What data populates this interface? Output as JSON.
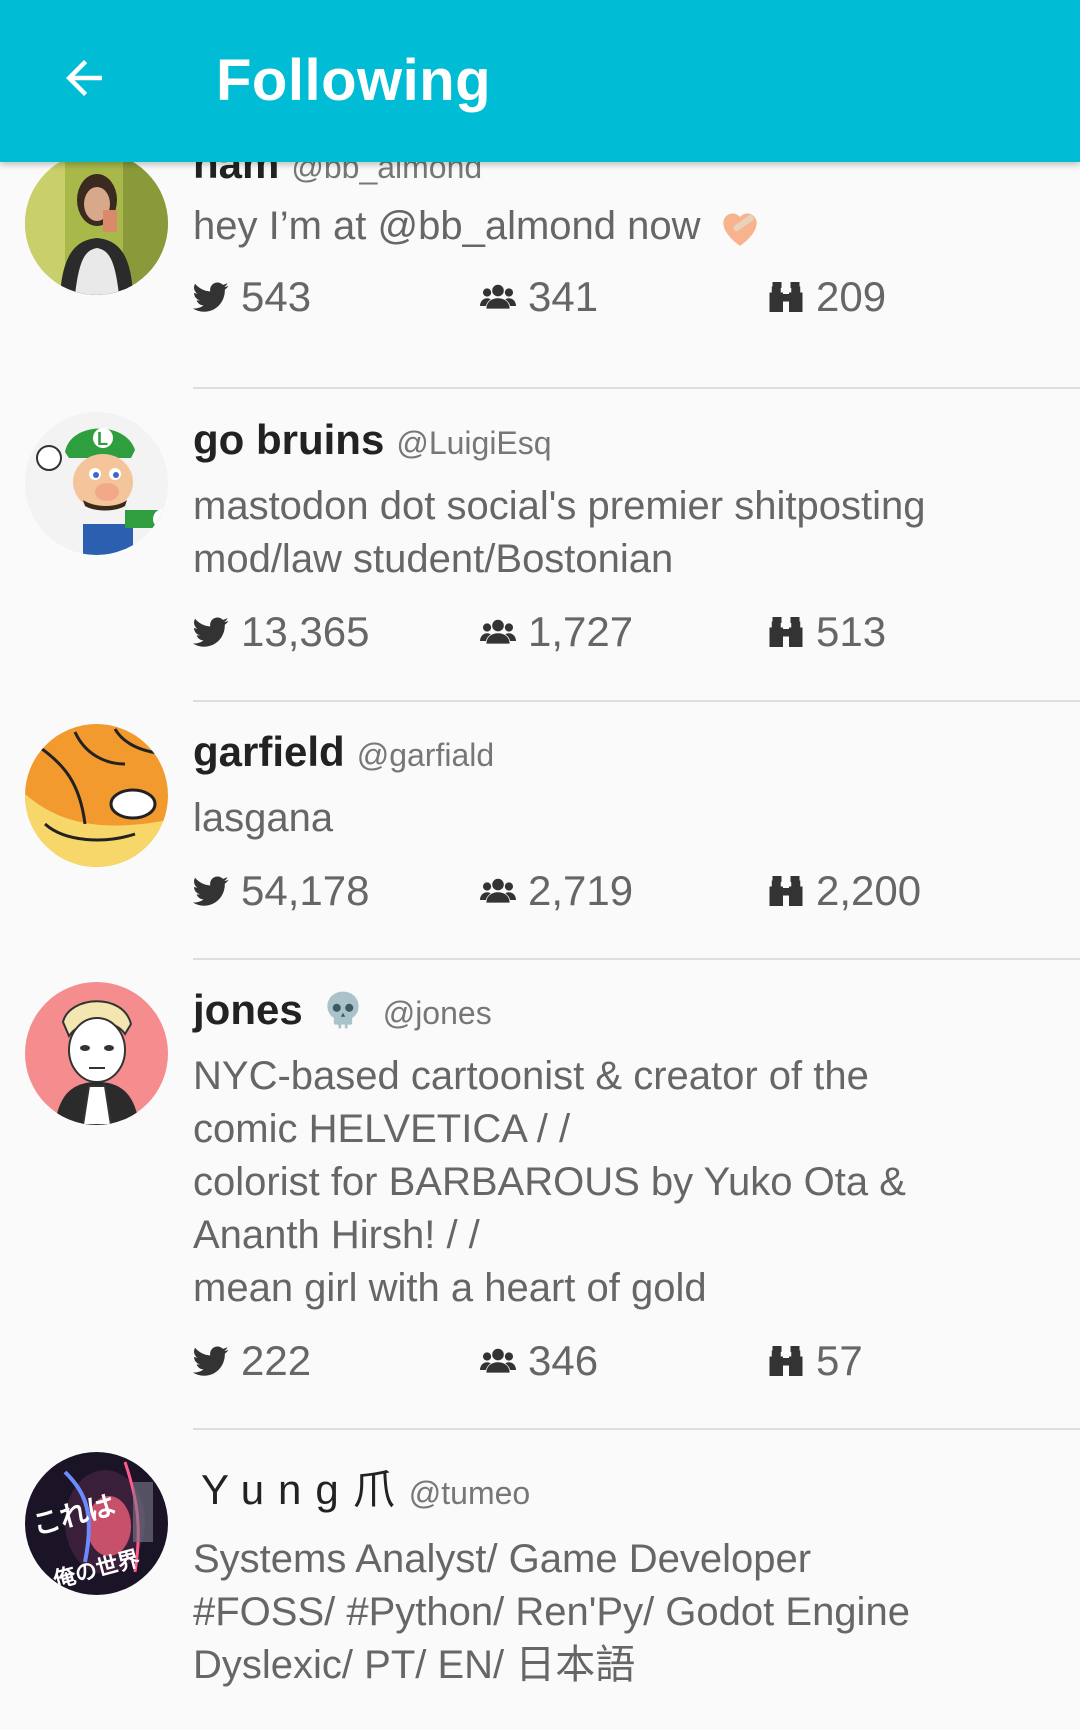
{
  "appbar": {
    "title": "Following",
    "back_icon": "arrow-left-icon",
    "background": "#00bcd4"
  },
  "accounts": [
    {
      "display_name": "ham",
      "handle": "@bb_almond",
      "bio": "hey I’m at @bb_almond now",
      "bio_emoji": "heart-with-bandage-emoji",
      "statuses": "543",
      "following": "341",
      "followers": "209"
    },
    {
      "display_name": "go bruins",
      "handle": "@LuigiEsq",
      "bio": "mastodon dot social's premier shitposting mod/law student/Bostonian",
      "statuses": "13,365",
      "following": "1,727",
      "followers": "513"
    },
    {
      "display_name": "garfield",
      "handle": "@garfiald",
      "bio": "lasgana",
      "statuses": "54,178",
      "following": "2,719",
      "followers": "2,200"
    },
    {
      "display_name": "jones",
      "name_emoji": "skull-emoji",
      "handle": "@jones",
      "bio": "NYC-based cartoonist & creator of the comic HELVETICA / /\ncolorist for BARBAROUS by Yuko Ota & Ananth Hirsh! / /\nmean girl with a heart of gold",
      "statuses": "222",
      "following": "346",
      "followers": "57"
    },
    {
      "display_name": "Yung爪",
      "handle": "@tumeo",
      "bio": "Systems Analyst/ Game Developer\n#FOSS/ #Python/ Ren'Py/ Godot Engine\nDyslexic/ PT/ EN/ 日本語"
    }
  ],
  "icons": {
    "statuses": "bird-icon",
    "following": "users-icon",
    "followers": "binoculars-icon"
  },
  "colors": {
    "accent": "#00bcd4",
    "text_primary": "#222222",
    "text_secondary": "#666666",
    "handle": "#777777",
    "divider": "#dedede",
    "background": "#fafafa"
  }
}
